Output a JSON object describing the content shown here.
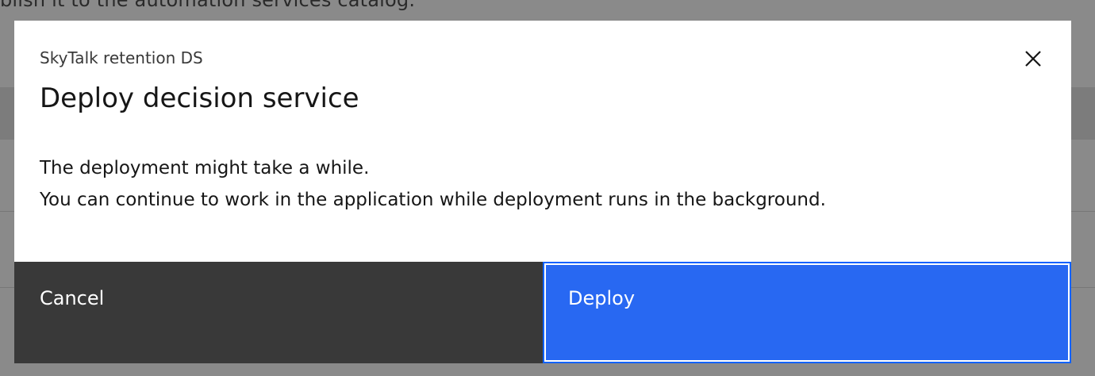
{
  "background": {
    "partial_text": "blish it to the automation services catalog."
  },
  "modal": {
    "label": "SkyTalk retention DS",
    "heading": "Deploy decision service",
    "close_icon": "close-icon",
    "body_lines": [
      "The deployment might take a while.",
      "You can continue to work in the application while deployment runs in the background."
    ],
    "buttons": {
      "cancel_label": "Cancel",
      "deploy_label": "Deploy"
    }
  },
  "colors": {
    "overlay": "#8a8a8a",
    "modal_bg": "#ffffff",
    "cancel_bg": "#393939",
    "primary": "#2868f2",
    "focus": "#0f62fe"
  }
}
